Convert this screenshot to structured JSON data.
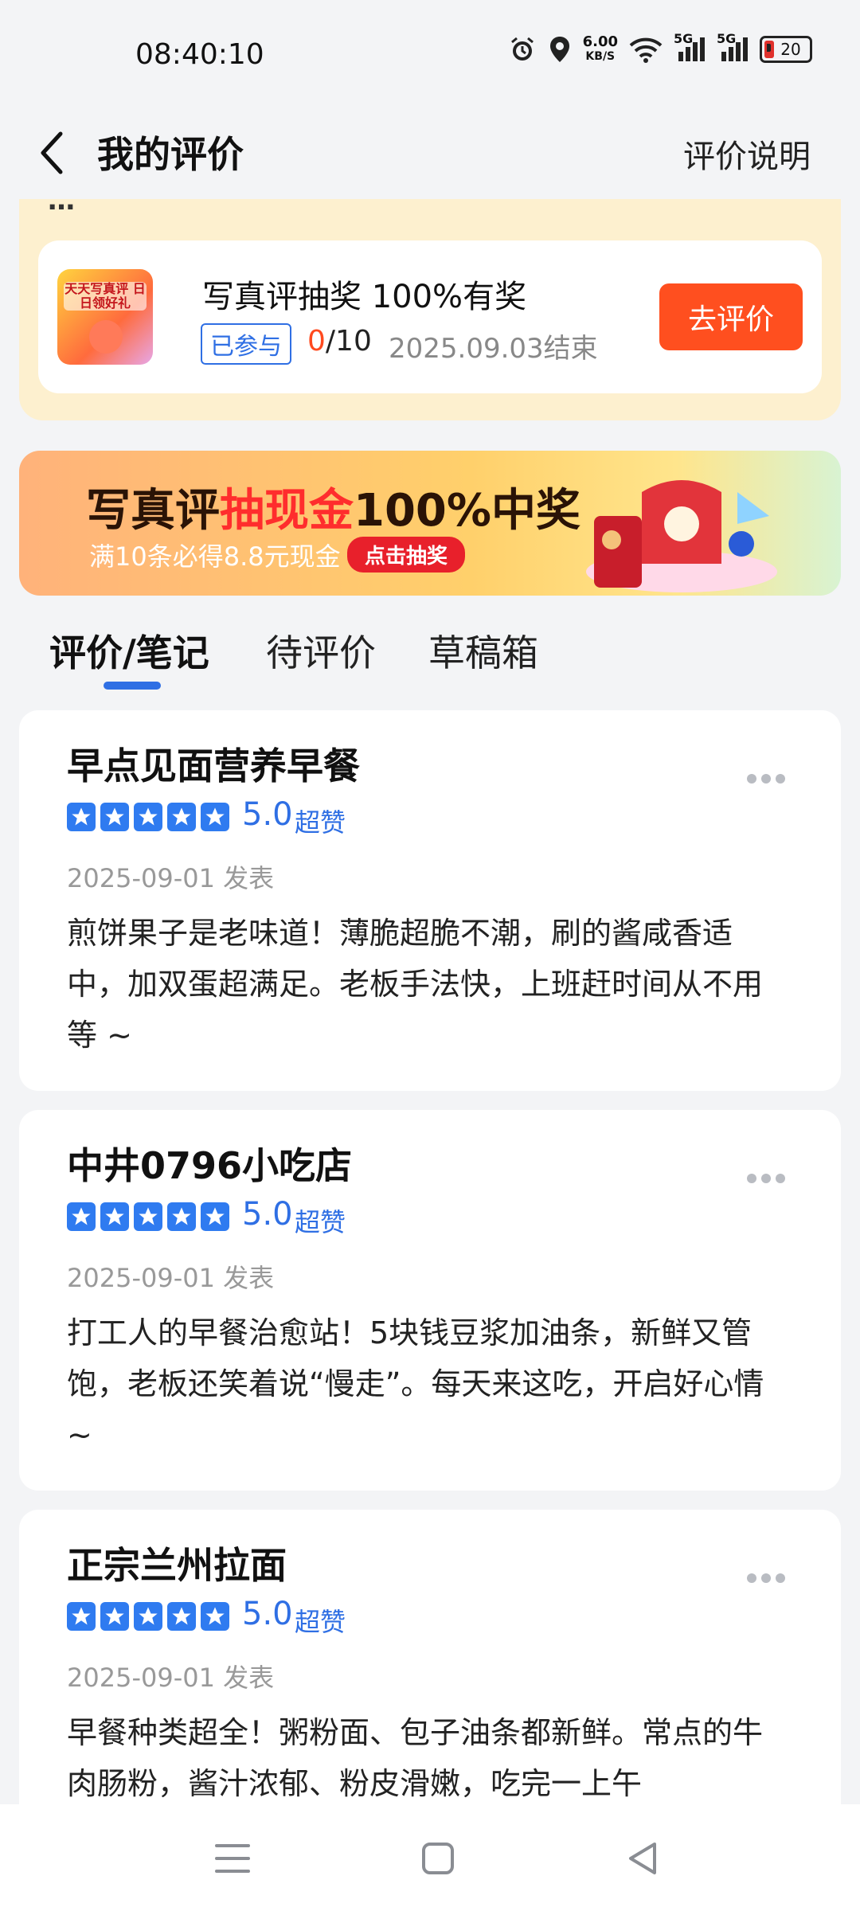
{
  "status_bar": {
    "time": "08:40:10",
    "speed_value": "6.00",
    "speed_unit": "KB/S",
    "signal_1": "5G",
    "signal_2": "5G",
    "battery": "20"
  },
  "header": {
    "title": "我的评价",
    "right_link": "评价说明"
  },
  "promo": {
    "peek_text": "…",
    "image_text": "天天写真评 日日领好礼",
    "title": "写真评抽奖 100%有奖",
    "joined_tag": "已参与",
    "progress_current": "0",
    "progress_total": "/10",
    "end_date": "2025.09.03结束",
    "button": "去评价"
  },
  "banner": {
    "title_prefix": "写真评",
    "title_highlight": "抽现金",
    "title_suffix": "100%中奖",
    "subtitle": "满10条必得8.8元现金",
    "button": "点击抽奖"
  },
  "tabs": [
    {
      "label": "评价/笔记",
      "active": true
    },
    {
      "label": "待评价",
      "active": false
    },
    {
      "label": "草稿箱",
      "active": false
    }
  ],
  "reviews": [
    {
      "shop": "早点见面营养早餐",
      "rating": "5.0",
      "rating_word": "超赞",
      "date": "2025-09-01 发表",
      "content": "煎饼果子是老味道！薄脆超脆不潮，刷的酱咸香适中，加双蛋超满足。老板手法快，上班赶时间从不用等 ~"
    },
    {
      "shop": "中井0796小吃店",
      "rating": "5.0",
      "rating_word": "超赞",
      "date": "2025-09-01 发表",
      "content": "打工人的早餐治愈站！5块钱豆浆加油条，新鲜又管饱，老板还笑着说“慢走”。每天来这吃，开启好心情 ~"
    },
    {
      "shop": "正宗兰州拉面",
      "rating": "5.0",
      "rating_word": "超赞",
      "date": "2025-09-01 发表",
      "content": "早餐种类超全！粥粉面、包子油条都新鲜。常点的牛肉肠粉，酱汁浓郁、粉皮滑嫩，吃完一上午"
    }
  ],
  "colors": {
    "accent_blue": "#2f6fe4",
    "accent_orange": "#ff4f1f",
    "promo_bg": "#fdf0cf"
  }
}
